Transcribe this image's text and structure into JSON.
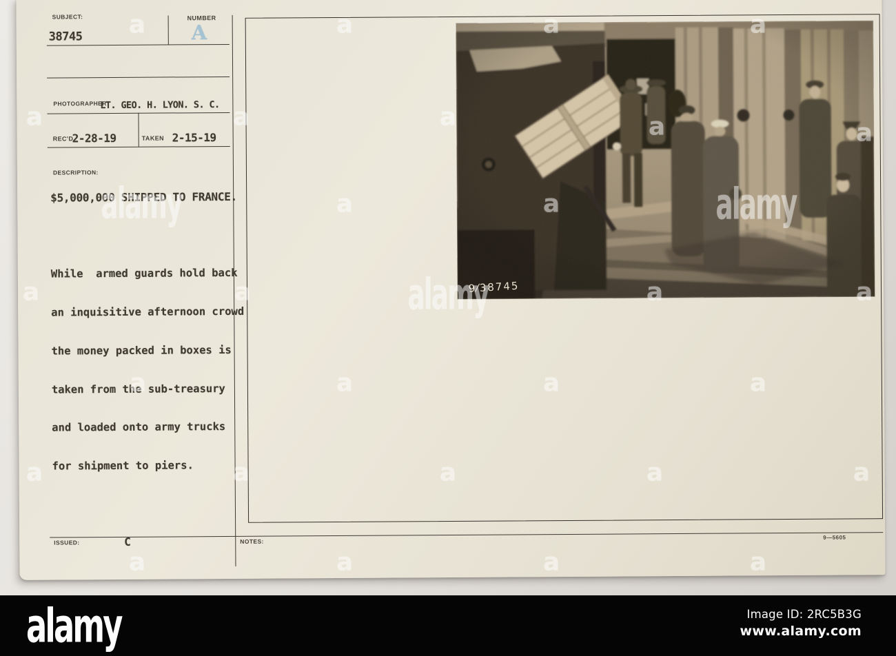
{
  "card": {
    "fields": {
      "subject_label": "SUBJECT:",
      "subject_value": "38745",
      "number_label": "NUMBER",
      "number_value": "A",
      "photographer_label": "PHOTOGRAPHER",
      "photographer_value": "LT. GEO. H. LYON. S. C.",
      "recd_label": "REC'D",
      "recd_value": "2-28-19",
      "taken_label": "TAKEN",
      "taken_value": "2-15-19",
      "description_label": "DESCRIPTION:",
      "description_headline": "$5,000,000 SHIPPED TO FRANCE.",
      "description_lines": [
        "While  armed guards hold back",
        "an inquisitive afternoon crowd",
        "the money packed in boxes is",
        "taken from the sub-treasury",
        "and loaded onto army trucks",
        "for shipment to piers."
      ],
      "issued_label": "ISSUED:",
      "issued_value": "C",
      "notes_label": "NOTES:",
      "ref_number": "9—5605"
    },
    "colors": {
      "card_cream": "#e9e5d8",
      "ink": "#403b31",
      "stamp_blue": "#a3c2d4"
    }
  },
  "photo": {
    "caption_number": "9⁄38745",
    "description": "Soldiers load a large wooden money crate from the sub-treasury onto an army truck while officers and a crowd look on"
  },
  "watermark": {
    "small_glyph": "a",
    "brand": "alamy"
  },
  "footer": {
    "brand": "alamy",
    "image_id_label": "Image ID:",
    "image_id": "2RC5B3G",
    "url": "www.alamy.com",
    "bar_color": "#050505"
  }
}
